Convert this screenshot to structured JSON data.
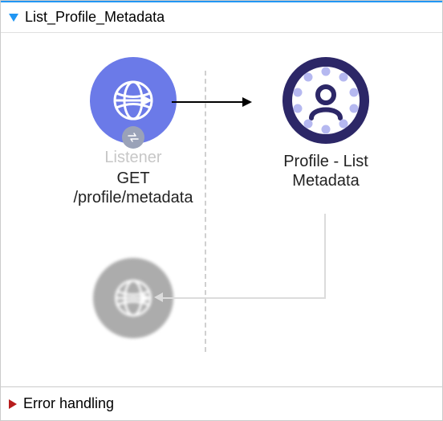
{
  "flow": {
    "title": "List_Profile_Metadata",
    "listener": {
      "typeLabel": "Listener",
      "methodPath": "GET /profile/metadata"
    },
    "processor": {
      "title": "Profile - List Metadata"
    }
  },
  "errorSection": {
    "title": "Error handling"
  }
}
